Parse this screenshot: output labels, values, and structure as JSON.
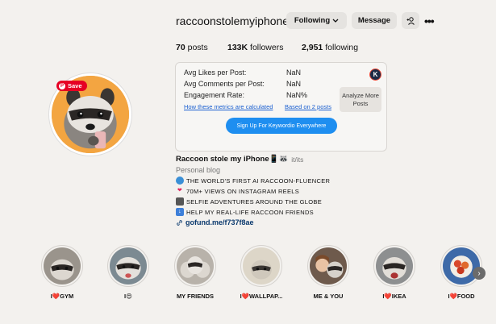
{
  "profile": {
    "username": "raccoonstolemyiphone",
    "save_label": "Save"
  },
  "actions": {
    "following_label": "Following",
    "message_label": "Message"
  },
  "stats": {
    "posts_count": "70",
    "posts_label": "posts",
    "followers_count": "133K",
    "followers_label": "followers",
    "following_count": "2,951",
    "following_label": "following"
  },
  "metrics": {
    "avg_likes_label": "Avg Likes per Post:",
    "avg_likes_value": "NaN",
    "avg_comments_label": "Avg Comments per Post:",
    "avg_comments_value": "NaN",
    "engagement_label": "Engagement Rate:",
    "engagement_value": "NaN%",
    "how_calculated_link": "How these metrics are calculated",
    "based_on_link": "Based on 2 posts",
    "analyze_label": "Analyze More Posts",
    "signup_label": "Sign Up For Keywordio Everywhere",
    "logo_letter": "K"
  },
  "bio": {
    "name": "Raccoon stole my iPhone📱🦝",
    "pronouns": "it/its",
    "category": "Personal blog",
    "lines": [
      "THE WORLD'S FIRST AI RACCOON-FLUENCER",
      "70M+ VIEWS ON INSTAGRAM REELS",
      "SELFIE ADVENTURES AROUND THE GLOBE",
      "HELP MY REAL-LIFE RACCOON FRIENDS"
    ],
    "link": "gofund.me/f737f8ae"
  },
  "highlights": [
    {
      "label": "I❤️GYM"
    },
    {
      "label": "I😍"
    },
    {
      "label": "MY FRIENDS"
    },
    {
      "label": "I❤️WALLPAP..."
    },
    {
      "label": "ME & YOU"
    },
    {
      "label": "I❤️IKEA"
    },
    {
      "label": "I❤️FOOD"
    }
  ],
  "colors": {
    "background": "#f3f1ee",
    "button_bg": "#e5e3e0",
    "signup_blue": "#1e8ef0",
    "link_blue": "#1a5fd0",
    "pinterest_red": "#e60023"
  },
  "icons": {
    "following_chevron": "chevron-down-icon",
    "add_user": "add-user-icon",
    "more": "more-options-icon",
    "bio_line_1": "globe-icon",
    "bio_line_2": "heart-icon",
    "bio_line_3": "camera-icon",
    "bio_line_4": "down-arrow-icon",
    "bio_link": "link-icon",
    "scroll": "chevron-right-icon"
  }
}
